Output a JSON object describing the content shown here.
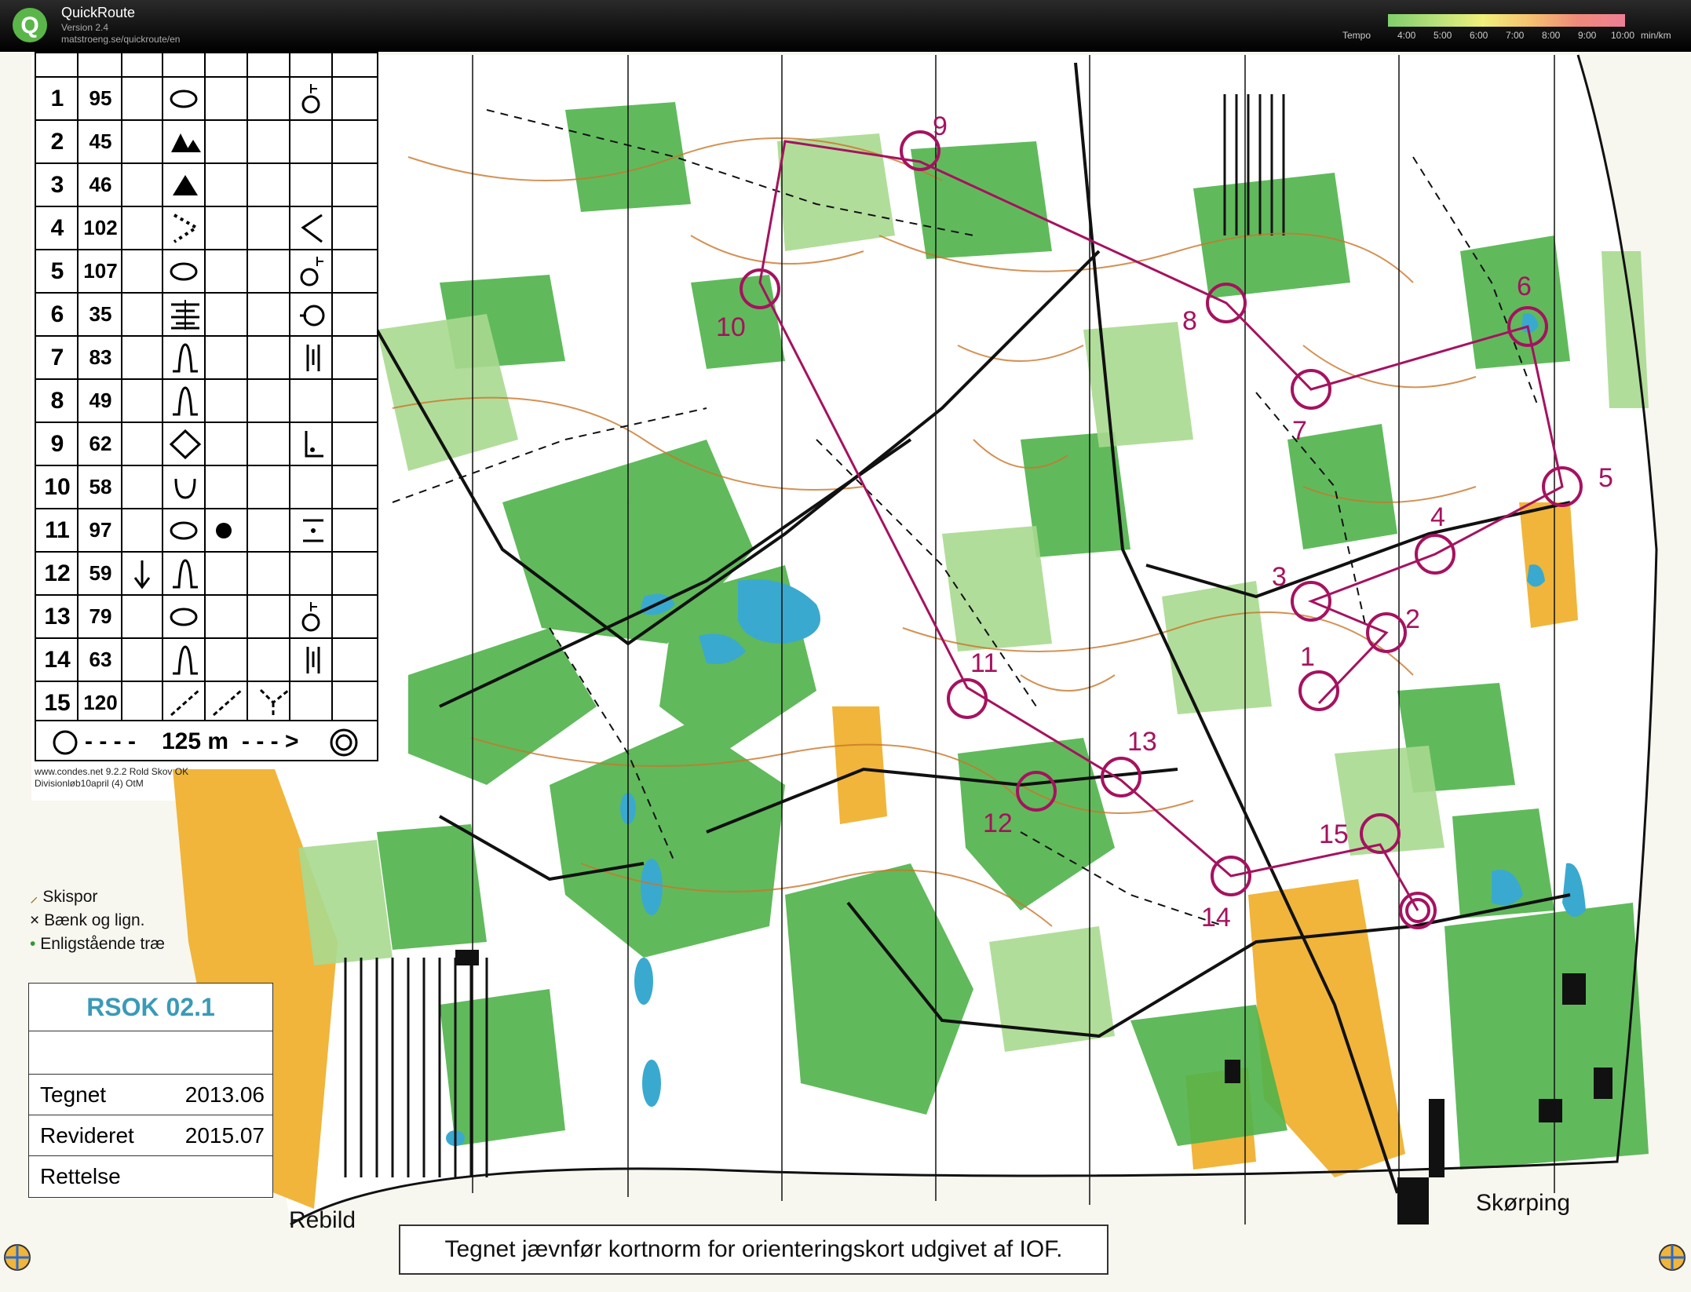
{
  "app": {
    "name": "QuickRoute",
    "version": "Version 2.4",
    "url": "matstroeng.se/quickroute/en"
  },
  "tempo": {
    "label": "Tempo",
    "ticks": [
      "4:00",
      "5:00",
      "6:00",
      "7:00",
      "8:00",
      "9:00",
      "10:00"
    ],
    "unit": "min/km"
  },
  "controls": [
    {
      "num": "1",
      "code": "95"
    },
    {
      "num": "2",
      "code": "45"
    },
    {
      "num": "3",
      "code": "46"
    },
    {
      "num": "4",
      "code": "102"
    },
    {
      "num": "5",
      "code": "107"
    },
    {
      "num": "6",
      "code": "35"
    },
    {
      "num": "7",
      "code": "83"
    },
    {
      "num": "8",
      "code": "49"
    },
    {
      "num": "9",
      "code": "62"
    },
    {
      "num": "10",
      "code": "58"
    },
    {
      "num": "11",
      "code": "97"
    },
    {
      "num": "12",
      "code": "59"
    },
    {
      "num": "13",
      "code": "79"
    },
    {
      "num": "14",
      "code": "63"
    },
    {
      "num": "15",
      "code": "120"
    }
  ],
  "finish_distance": "125 m",
  "footer": {
    "line1": "www.condes.net 9.2.2 Rold Skov OK",
    "line2": "Divisionløb10april (4) OtM"
  },
  "legend": [
    {
      "marker": "⸝",
      "text": "Skispor"
    },
    {
      "marker": "×",
      "text": "Bænk og lign."
    },
    {
      "marker": "•",
      "text": "Enligstående træ"
    }
  ],
  "map_info": {
    "id": "RSOK 02.1",
    "rows": [
      {
        "label": "Tegnet",
        "value": "2013.06"
      },
      {
        "label": "Revideret",
        "value": "2015.07"
      },
      {
        "label": "Rettelse",
        "value": ""
      }
    ]
  },
  "places": {
    "west": "Rebild",
    "east": "Skørping"
  },
  "iof_note": "Tegnet jævnfør kortnorm for orienteringskort udgivet af IOF.",
  "course_labels": [
    "1",
    "2",
    "3",
    "4",
    "5",
    "6",
    "7",
    "8",
    "9",
    "10",
    "11",
    "12",
    "13",
    "14",
    "15"
  ],
  "colors": {
    "course": "#a6125f",
    "forest_green": "#4fb24a",
    "light_green": "#a9d98f",
    "open_yellow": "#f0b53a",
    "water": "#3aa9cf",
    "contour": "#c9772a"
  }
}
